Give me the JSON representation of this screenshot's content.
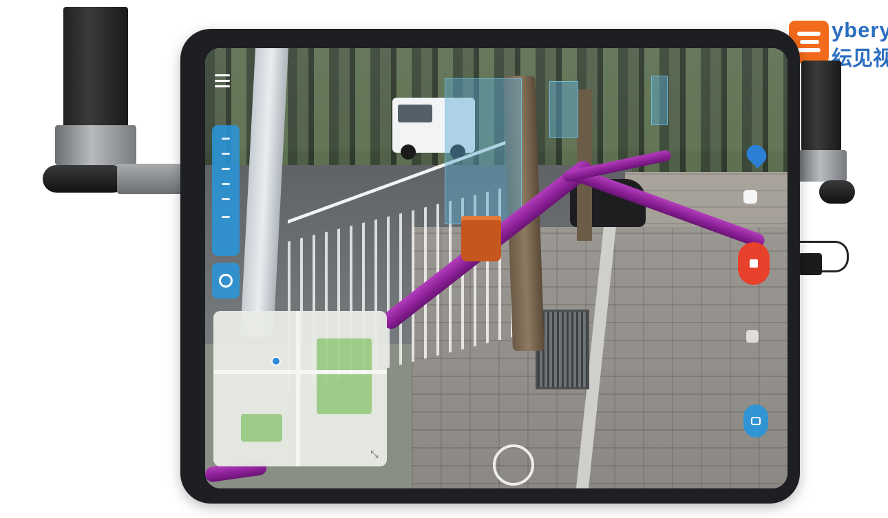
{
  "brand": {
    "name_latin": "ybery",
    "name_cn": "纭见视"
  },
  "ar_app": {
    "record_state": "recording",
    "accent_color": "#2a96dc",
    "record_color": "#e8412b",
    "pipe_color": "#9b2aa6"
  },
  "icons": [
    "menu-icon",
    "locate-icon",
    "map-pin-icon",
    "camera-icon",
    "stop-icon",
    "layers-icon",
    "compass-icon",
    "expand-icon"
  ]
}
